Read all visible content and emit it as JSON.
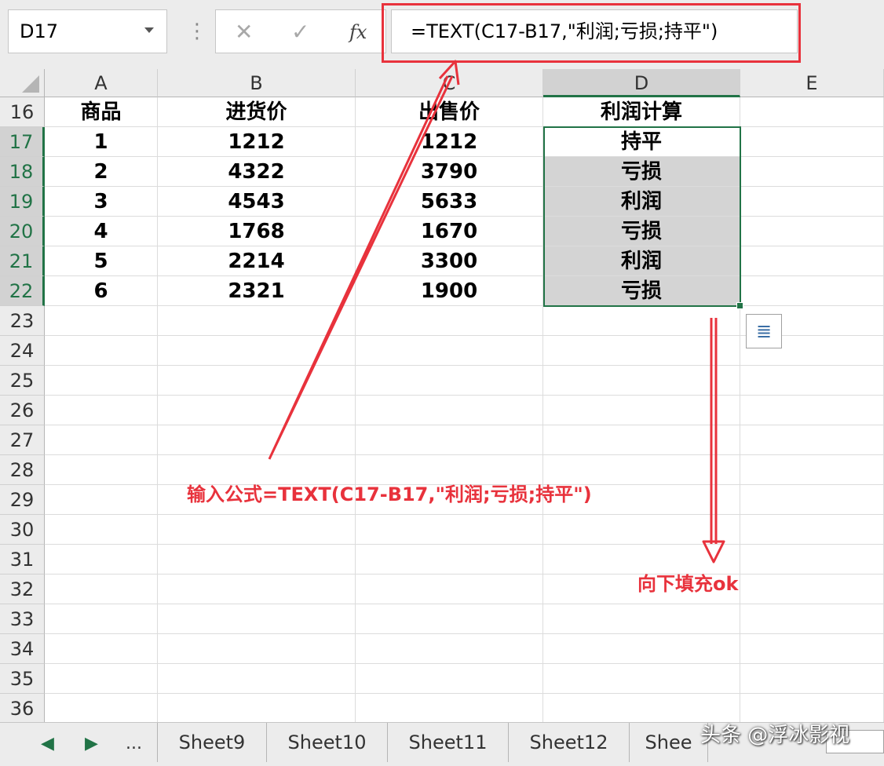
{
  "name_box": "D17",
  "formula_bar": {
    "cancel_glyph": "✕",
    "enter_glyph": "✓",
    "fx_label": "fx",
    "formula": "=TEXT(C17-B17,\"利润;亏损;持平\")"
  },
  "columns": [
    "A",
    "B",
    "C",
    "D",
    "E"
  ],
  "selected_column": "D",
  "rows": [
    {
      "num": "16",
      "cells": [
        "商品",
        "进货价",
        "出售价",
        "利润计算"
      ]
    },
    {
      "num": "17",
      "cells": [
        "1",
        "1212",
        "1212",
        "持平"
      ]
    },
    {
      "num": "18",
      "cells": [
        "2",
        "4322",
        "3790",
        "亏损"
      ]
    },
    {
      "num": "19",
      "cells": [
        "3",
        "4543",
        "5633",
        "利润"
      ]
    },
    {
      "num": "20",
      "cells": [
        "4",
        "1768",
        "1670",
        "亏损"
      ]
    },
    {
      "num": "21",
      "cells": [
        "5",
        "2214",
        "3300",
        "利润"
      ]
    },
    {
      "num": "22",
      "cells": [
        "6",
        "2321",
        "1900",
        "亏损"
      ]
    },
    {
      "num": "23",
      "cells": [
        "",
        "",
        "",
        ""
      ]
    },
    {
      "num": "24",
      "cells": [
        "",
        "",
        "",
        ""
      ]
    },
    {
      "num": "25",
      "cells": [
        "",
        "",
        "",
        ""
      ]
    },
    {
      "num": "26",
      "cells": [
        "",
        "",
        "",
        ""
      ]
    },
    {
      "num": "27",
      "cells": [
        "",
        "",
        "",
        ""
      ]
    },
    {
      "num": "28",
      "cells": [
        "",
        "",
        "",
        ""
      ]
    },
    {
      "num": "29",
      "cells": [
        "",
        "",
        "",
        ""
      ]
    },
    {
      "num": "30",
      "cells": [
        "",
        "",
        "",
        ""
      ]
    },
    {
      "num": "31",
      "cells": [
        "",
        "",
        "",
        ""
      ]
    },
    {
      "num": "32",
      "cells": [
        "",
        "",
        "",
        ""
      ]
    },
    {
      "num": "33",
      "cells": [
        "",
        "",
        "",
        ""
      ]
    },
    {
      "num": "34",
      "cells": [
        "",
        "",
        "",
        ""
      ]
    },
    {
      "num": "35",
      "cells": [
        "",
        "",
        "",
        ""
      ]
    },
    {
      "num": "36",
      "cells": [
        "",
        "",
        "",
        ""
      ]
    }
  ],
  "annotations": {
    "formula_note": "输入公式=TEXT(C17-B17,\"利润;亏损;持平\")",
    "fill_note": "向下填充ok"
  },
  "sheet_tabs": [
    "Sheet9",
    "Sheet10",
    "Sheet11",
    "Sheet12",
    "Shee"
  ],
  "nav": {
    "prev": "◀",
    "next": "▶",
    "more": "..."
  },
  "watermark": "头条 @浮冰影视",
  "colors": {
    "accent_green": "#217346",
    "annotation_red": "#e8323c",
    "selection_fill": "#d4d4d4"
  }
}
